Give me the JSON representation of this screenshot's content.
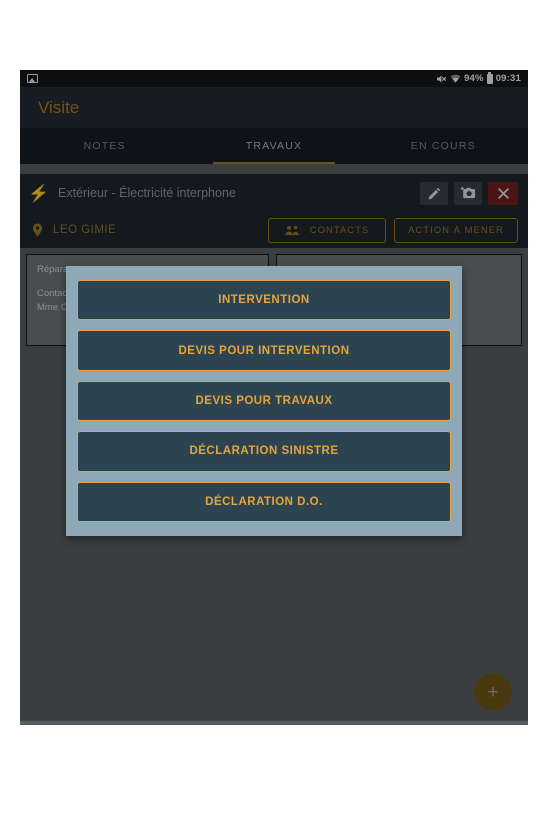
{
  "status_bar": {
    "gallery_icon": "gallery-icon",
    "mute_icon": "volume-muted-icon",
    "wifi_icon": "wifi-icon",
    "battery_percent": "94%",
    "battery_icon": "battery-icon",
    "time": "09:31"
  },
  "app_bar": {
    "title": "Visite"
  },
  "tabs": [
    {
      "label": "NOTES",
      "active": false
    },
    {
      "label": "TRAVAUX",
      "active": true
    },
    {
      "label": "EN COURS",
      "active": false
    }
  ],
  "item_header": {
    "category_icon": "lightning-bolt-icon",
    "title": "Extérieur - Électricité interphone",
    "edit_label": "edit-icon",
    "camera_label": "add-photo-icon",
    "close_label": "close-icon"
  },
  "contact_row": {
    "pin_icon": "location-pin-icon",
    "name": "LEO GIMIE",
    "contacts_label": "CONTACTS",
    "contacts_icon": "people-icon",
    "action_label": "ACTION À MENER"
  },
  "cards": [
    {
      "title": "Réparation",
      "line1": "Contact",
      "line2": "Mme CO"
    },
    {
      "title": "",
      "line1": "",
      "line2": ""
    }
  ],
  "dialog": {
    "options": [
      "INTERVENTION",
      "DEVIS POUR INTERVENTION",
      "DEVIS POUR TRAVAUX",
      "DÉCLARATION SINISTRE",
      "DÉCLARATION D.O."
    ]
  },
  "fab": {
    "label": "+",
    "icon": "add-icon"
  },
  "colors": {
    "accent_orange": "#e7a33d",
    "title_amber": "#b3761e",
    "dialog_bg": "#8fa8b7",
    "button_bg": "#2b4450",
    "app_bar_bg": "#222b33",
    "tab_bar_bg": "#161d24",
    "content_bg": "#575c60",
    "close_red": "#6e1f1f"
  }
}
